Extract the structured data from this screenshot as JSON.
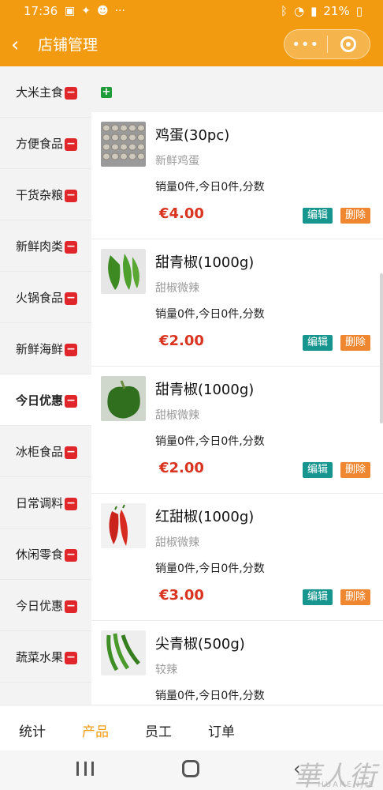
{
  "status_bar": {
    "time": "17:36",
    "battery": "21%"
  },
  "header": {
    "title": "店铺管理"
  },
  "sidebar": {
    "items": [
      {
        "label": "大米主食",
        "active": false
      },
      {
        "label": "方便食品",
        "active": false
      },
      {
        "label": "干货杂粮",
        "active": false
      },
      {
        "label": "新鲜肉类",
        "active": false
      },
      {
        "label": "火锅食品",
        "active": false
      },
      {
        "label": "新鲜海鲜",
        "active": false
      },
      {
        "label": "今日优惠",
        "active": true
      },
      {
        "label": "冰柜食品",
        "active": false
      },
      {
        "label": "日常调料",
        "active": false
      },
      {
        "label": "休闲零食",
        "active": false
      },
      {
        "label": "今日优惠",
        "active": false
      },
      {
        "label": "蔬菜水果",
        "active": false
      }
    ]
  },
  "products": [
    {
      "name": "鸡蛋(30pc)",
      "desc": "新鲜鸡蛋",
      "stats": "销量0件,今日0件,分数",
      "price": "€4.00",
      "thumb": "egg-tray"
    },
    {
      "name": "甜青椒(1000g)",
      "desc": "甜椒微辣",
      "stats": "销量0件,今日0件,分数",
      "price": "€2.00",
      "thumb": "green-pepper-long"
    },
    {
      "name": "甜青椒(1000g)",
      "desc": "甜椒微辣",
      "stats": "销量0件,今日0件,分数",
      "price": "€2.00",
      "thumb": "green-bell-pepper"
    },
    {
      "name": "红甜椒(1000g)",
      "desc": "甜椒微辣",
      "stats": "销量0件,今日0件,分数",
      "price": "€3.00",
      "thumb": "red-pepper"
    },
    {
      "name": "尖青椒(500g)",
      "desc": "较辣",
      "stats": "销量0件,今日0件,分数",
      "price": "",
      "thumb": "green-chili"
    }
  ],
  "buttons": {
    "edit": "编辑",
    "delete": "删除"
  },
  "tabbar": {
    "tabs": [
      {
        "label": "统计",
        "active": false
      },
      {
        "label": "产品",
        "active": true
      },
      {
        "label": "员工",
        "active": false
      },
      {
        "label": "订单",
        "active": false
      }
    ]
  },
  "watermark": {
    "main": "華人街",
    "sub": "HUARENJIE"
  },
  "colors": {
    "brand": "#f39b10",
    "price": "#d9341f",
    "edit": "#17968f",
    "delete": "#ef8630",
    "badge": "#e0262a",
    "add": "#1f9b39"
  }
}
